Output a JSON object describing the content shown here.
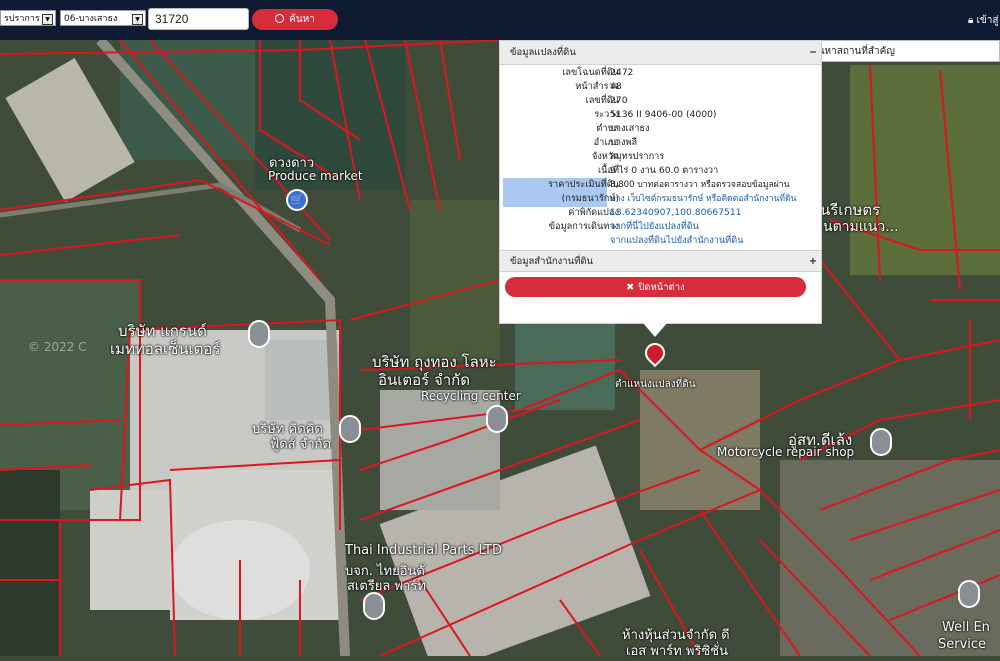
{
  "topbar": {
    "province": "รปราการ",
    "district": "06-บางเสาธง",
    "search_value": "31720",
    "search_button": "ค้นหา",
    "login": "เข้าสู่"
  },
  "panel": {
    "title": "ข้อมูลแปลงที่ดิน",
    "title_toggle": "−",
    "rows": [
      {
        "k": "เลขโฉนดที่ดิน",
        "v": "2472"
      },
      {
        "k": "หน้าสำรวจ",
        "v": "48"
      },
      {
        "k": "เลขที่ดิน",
        "v": "270"
      },
      {
        "k": "ระวาง",
        "v": "5136 II 9406-00 (4000)"
      },
      {
        "k": "ตำบล",
        "v": "บางเสาธง"
      },
      {
        "k": "อำเภอ",
        "v": "บางพลี"
      },
      {
        "k": "จังหวัด",
        "v": "สมุทรปราการ"
      },
      {
        "k": "เนื้อที่",
        "v": "9 ไร่ 0 งาน 60.0 ตารางวา"
      }
    ],
    "price_key_1": "ราคาประเมินที่ดิน",
    "price_key_2": "(กรมธนารักษ์)",
    "price_val_1": "8,800 บาทต่อตารางวา หรือตรวจสอบข้อมูลผ่าน",
    "price_val_2": "ทาง เว็บไซต์กรมธนารักษ์ หรือติดต่อสำนักงานที่ดิน",
    "coord_key": "ค่าพิกัดแปลง",
    "coord_val": "13.62340907,100.80667511",
    "travel_key": "ข้อมูลการเดินทาง",
    "travel_link_1": "จากที่นี่ไปยังแปลงที่ดิน",
    "travel_link_2": "จากแปลงที่ดินไปยังสำนักงานที่ดิน",
    "office_title": "ข้อมูลสำนักงานที่ดิน",
    "office_toggle": "+",
    "close_button": "ปิดหน้าต่าง"
  },
  "place_search_placeholder": "ค้นหาสถานที่สำคัญ",
  "map": {
    "labels": {
      "duangdao": "ดวงดาว",
      "produce_market": "Produce market",
      "grand": "บริษัท แกรนด์",
      "metal": "เมททอลเซ็นเตอร์",
      "copyright": "© 2022 C",
      "thungthong": "บริษัท ถุงทอง โลหะ",
      "inter": "อินเตอร์ จำกัด",
      "recycling": "Recycling center",
      "food_1": "บริษัท คิดคิด",
      "food_2": "ฟู้ดส์ จำกัด",
      "marker_caption": "ตำแหน่งแปลงที่ดิน",
      "moto_th": "อู่สท.ดีเล้ง",
      "moto_en": "Motorcycle repair shop",
      "thai_parts": "Thai Industrial Parts LTD",
      "thai_parts_th1": "บจก. ไทยอินดั",
      "thai_parts_th2": "สเตรียล พาร์ท",
      "partnership_1": "ห้างหุ้นส่วนจำกัด ดี",
      "partnership_2": "เอส พาร์ท พริซิชั่น",
      "well_1": "Well En",
      "well_2": "Service",
      "kaset_1": "นรีเกษตร",
      "kaset_2": "นตามแนว..."
    }
  },
  "colors": {
    "topbar": "#0f1b33",
    "accent_red": "#d72c3c",
    "parcel_line": "#e0141e",
    "link_blue": "#1a5fb4",
    "highlight": "#a9c8f2"
  }
}
